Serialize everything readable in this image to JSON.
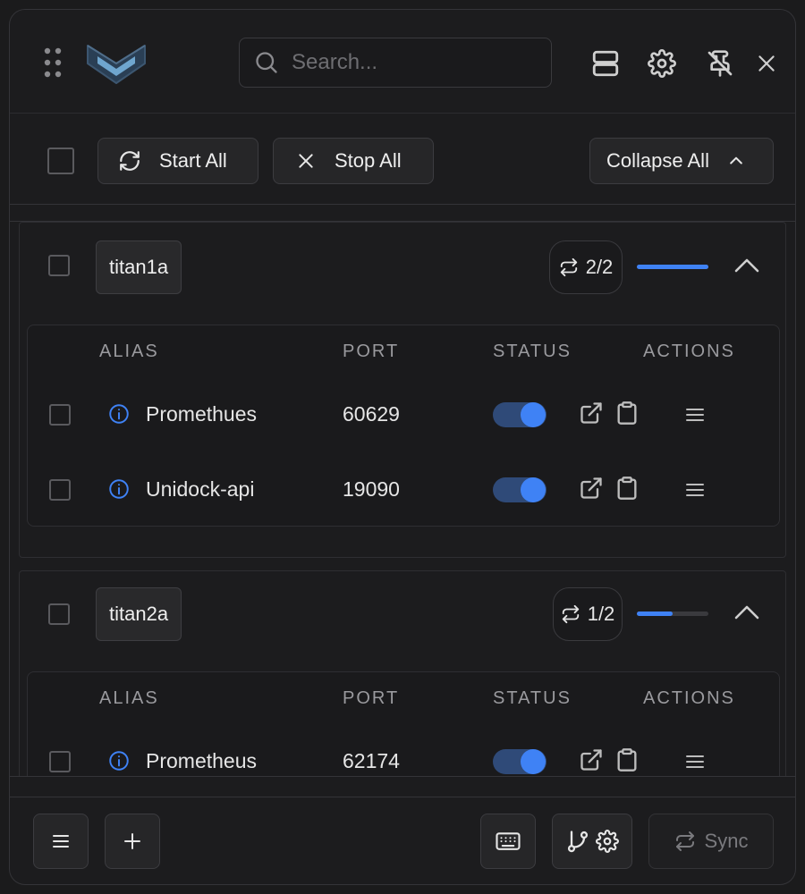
{
  "search": {
    "placeholder": "Search..."
  },
  "toolbar": {
    "start_all": "Start All",
    "stop_all": "Stop All",
    "collapse_all": "Collapse All"
  },
  "columns": {
    "alias": "ALIAS",
    "port": "PORT",
    "status": "STATUS",
    "actions": "ACTIONS"
  },
  "groups": [
    {
      "name": "titan1a",
      "count": "2/2",
      "progress": 1.0,
      "rows": [
        {
          "alias": "Promethues",
          "port": "60629",
          "status_on": true
        },
        {
          "alias": "Unidock-api",
          "port": "19090",
          "status_on": true
        }
      ]
    },
    {
      "name": "titan2a",
      "count": "1/2",
      "progress": 0.5,
      "rows": [
        {
          "alias": "Prometheus",
          "port": "62174",
          "status_on": true
        }
      ]
    }
  ],
  "footer": {
    "sync_label": "Sync"
  },
  "icons": {
    "header": [
      "drag-grip-icon",
      "app-logo-icon",
      "search-icon",
      "server-icon",
      "gear-icon",
      "unpin-icon",
      "close-icon"
    ],
    "toolbar": [
      "refresh-icon",
      "x-icon",
      "chevron-up-icon"
    ],
    "row": [
      "info-icon",
      "external-link-icon",
      "clipboard-icon",
      "menu-icon"
    ],
    "footer": [
      "menu-icon",
      "plus-icon",
      "keyboard-icon",
      "git-branch-icon",
      "gear-icon",
      "sync-icon"
    ]
  },
  "colors": {
    "accent": "#3f82f5",
    "toggle_track": "#2f4a78",
    "background": "#1c1c1e"
  }
}
